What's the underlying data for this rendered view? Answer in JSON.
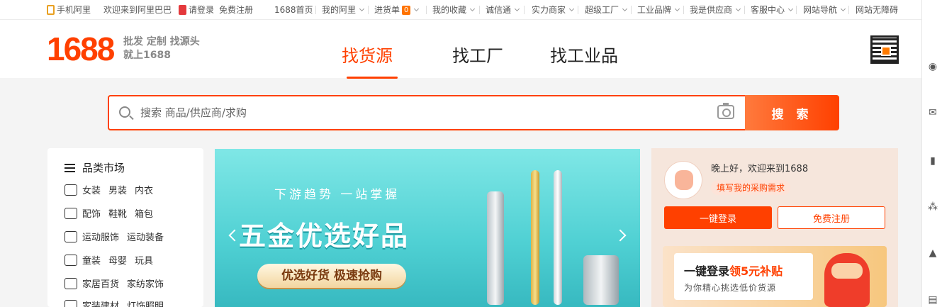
{
  "topbar": {
    "mobile": "手机阿里",
    "welcome": "欢迎来到阿里巴巴",
    "login": "请登录",
    "register": "免费注册",
    "home": "1688首页",
    "my_alibaba": "我的阿里",
    "purchase_list": "进货单",
    "purchase_count": "0",
    "favorites": "我的收藏",
    "trust": "诚信通",
    "merchants": "实力商家",
    "super_factory": "超级工厂",
    "industrial_brand": "工业品牌",
    "supplier": "我是供应商",
    "service": "客服中心",
    "site_nav": "网站导航",
    "accessible": "网站无障碍"
  },
  "header": {
    "logo": "1688",
    "slogan_line1": "批发 定制 找源头",
    "slogan_line2": "就上1688",
    "tabs": [
      "找货源",
      "找工厂",
      "找工业品"
    ]
  },
  "search": {
    "placeholder": "搜索 商品/供应商/求购",
    "button": "搜 索"
  },
  "categories": {
    "title": "品类市场",
    "rows": [
      [
        "女装",
        "男装",
        "内衣"
      ],
      [
        "配饰",
        "鞋靴",
        "箱包"
      ],
      [
        "运动服饰",
        "运动装备"
      ],
      [
        "童装",
        "母婴",
        "玩具"
      ],
      [
        "家居百货",
        "家纺家饰"
      ],
      [
        "家装建材",
        "灯饰照明"
      ]
    ]
  },
  "banner": {
    "subtitle": "下游趋势 一站掌握",
    "title": "五金优选好品",
    "pill": "优选好货 极速抢购"
  },
  "user_panel": {
    "greeting": "晚上好，欢迎来到1688",
    "request": "填写我的采购需求",
    "login_button": "一键登录",
    "register_button": "免费注册",
    "promo_prefix": "一键登录",
    "promo_highlight": "领5元补贴",
    "promo_sub": "为你精心挑选低价货源"
  },
  "colors": {
    "brand": "#ff4000",
    "banner": "#4fd0d3"
  }
}
